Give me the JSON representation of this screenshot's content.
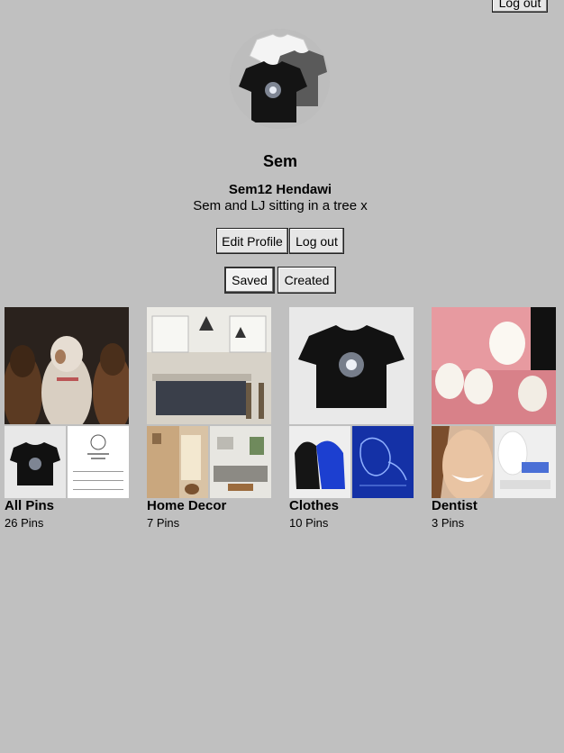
{
  "header": {
    "logout_label": "Log out"
  },
  "profile": {
    "avatar_icon": "tshirts-photo",
    "display_name": "Sem",
    "full_name": "Sem12 Hendawi",
    "bio": "Sem and LJ sitting in a tree x",
    "edit_label": "Edit Profile",
    "logout_label": "Log out"
  },
  "tabs": [
    {
      "label": "Saved",
      "selected": true
    },
    {
      "label": "Created",
      "selected": false
    }
  ],
  "boards": [
    {
      "title": "All Pins",
      "count": "26 Pins"
    },
    {
      "title": "Home Decor",
      "count": "7 Pins"
    },
    {
      "title": "Clothes",
      "count": "10 Pins"
    },
    {
      "title": "Dentist",
      "count": "3 Pins"
    }
  ]
}
